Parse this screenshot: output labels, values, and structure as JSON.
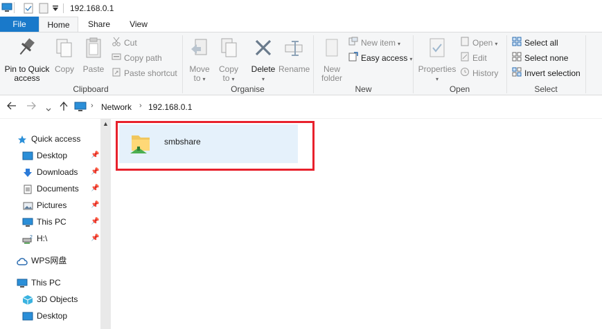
{
  "title_bar": {
    "path": "192.168.0.1"
  },
  "tabs": [
    {
      "label": "File"
    },
    {
      "label": "Home"
    },
    {
      "label": "Share"
    },
    {
      "label": "View"
    }
  ],
  "ribbon": {
    "clipboard": {
      "group_label": "Clipboard",
      "pin_label_line1": "Pin to Quick",
      "pin_label_line2": "access",
      "copy_label": "Copy",
      "paste_label": "Paste",
      "cut_label": "Cut",
      "copy_path_label": "Copy path",
      "paste_shortcut_label": "Paste shortcut"
    },
    "organise": {
      "group_label": "Organise",
      "move_to_line1": "Move",
      "move_to_line2": "to",
      "copy_to_line1": "Copy",
      "copy_to_line2": "to",
      "delete_label": "Delete",
      "rename_label": "Rename"
    },
    "new": {
      "group_label": "New",
      "new_folder_line1": "New",
      "new_folder_line2": "folder",
      "new_item_label": "New item",
      "easy_access_label": "Easy access"
    },
    "open": {
      "group_label": "Open",
      "properties_label": "Properties",
      "open_label": "Open",
      "edit_label": "Edit",
      "history_label": "History"
    },
    "select": {
      "group_label": "Select",
      "select_all_label": "Select all",
      "select_none_label": "Select none",
      "invert_selection_label": "Invert selection"
    }
  },
  "address_bar": {
    "breadcrumbs": [
      "Network",
      "192.168.0.1"
    ]
  },
  "nav_pane": {
    "items": [
      {
        "label": "Quick access"
      },
      {
        "label": "Desktop"
      },
      {
        "label": "Downloads"
      },
      {
        "label": "Documents"
      },
      {
        "label": "Pictures"
      },
      {
        "label": "This PC"
      },
      {
        "label": "H:\\"
      },
      {
        "label": "WPS网盘"
      },
      {
        "label": "This PC"
      },
      {
        "label": "3D Objects"
      },
      {
        "label": "Desktop"
      }
    ]
  },
  "content": {
    "items": [
      {
        "label": "smbshare"
      }
    ],
    "highlight_color": "#e8212c"
  },
  "colors": {
    "file_tab": "#1979ca",
    "selection": "#e5f1fb",
    "ribbon_bg": "#f5f6f7"
  }
}
